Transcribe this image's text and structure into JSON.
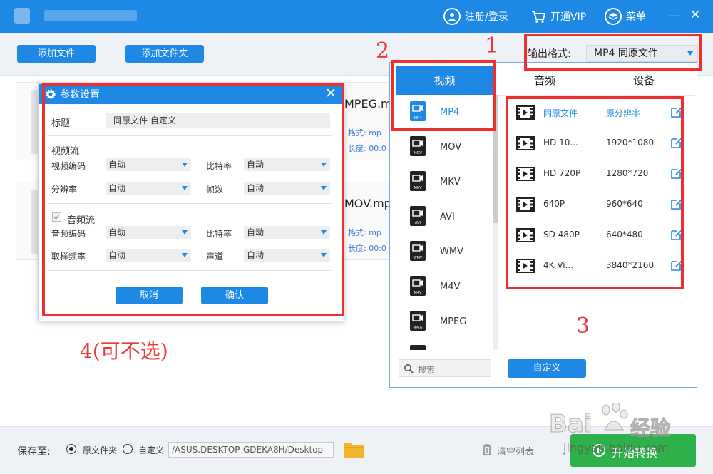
{
  "titlebar": {
    "login_label": "注册/登录",
    "vip_label": "开通VIP",
    "menu_label": "菜单",
    "minimize": "—",
    "close": "✕"
  },
  "toolbar": {
    "add_file": "添加文件",
    "add_folder": "添加文件夹"
  },
  "files": [
    {
      "name": "MPEG.m",
      "format_label": "格式: mp",
      "length_label": "长度: 00:0"
    },
    {
      "name": "MOV.mp",
      "format_label": "格式: mp",
      "length_label": "长度: 00:0"
    }
  ],
  "params_dialog": {
    "title": "参数设置",
    "title_label": "标题",
    "title_value": "同原文件 自定义",
    "video_section": "视频流",
    "video_codec_label": "视频编码",
    "video_codec_value": "自动",
    "video_bitrate_label": "比特率",
    "video_bitrate_value": "自动",
    "resolution_label": "分辨率",
    "resolution_value": "自动",
    "fps_label": "帧数",
    "fps_value": "自动",
    "audio_section": "音频流",
    "audio_codec_label": "音频编码",
    "audio_codec_value": "自动",
    "audio_bitrate_label": "比特率",
    "audio_bitrate_value": "自动",
    "sample_rate_label": "取样频率",
    "sample_rate_value": "自动",
    "channels_label": "声道",
    "channels_value": "自动",
    "cancel": "取消",
    "confirm": "确认"
  },
  "output": {
    "label": "输出格式:",
    "value": "MP4  同原文件"
  },
  "format_panel": {
    "tabs": [
      "视频",
      "音频",
      "设备"
    ],
    "active_tab": "视频",
    "formats": [
      {
        "label": "MP4",
        "tag": "MP4",
        "selected": true
      },
      {
        "label": "MOV",
        "tag": "MOV",
        "selected": false
      },
      {
        "label": "MKV",
        "tag": "MKV",
        "selected": false
      },
      {
        "label": "AVI",
        "tag": "AVI",
        "selected": false
      },
      {
        "label": "WMV",
        "tag": "WMV",
        "selected": false
      },
      {
        "label": "M4V",
        "tag": "M4V",
        "selected": false
      },
      {
        "label": "MPEG",
        "tag": "MPEG",
        "selected": false
      }
    ],
    "presets": [
      {
        "name": "同原文件",
        "resolution": "原分辨率",
        "highlight": true
      },
      {
        "name": "HD 10...",
        "resolution": "1920*1080",
        "highlight": false
      },
      {
        "name": "HD 720P",
        "resolution": "1280*720",
        "highlight": false
      },
      {
        "name": "640P",
        "resolution": "960*640",
        "highlight": false
      },
      {
        "name": "SD 480P",
        "resolution": "640*480",
        "highlight": false
      },
      {
        "name": "4K Vi...",
        "resolution": "3840*2160",
        "highlight": false
      }
    ],
    "search_placeholder": "搜索",
    "custom_button": "自定义"
  },
  "annotations": [
    "1",
    "2",
    "3",
    "4(可不选)"
  ],
  "bottom": {
    "save_to_label": "保存至:",
    "radio_source": "原文件夹",
    "radio_custom": "自定义",
    "path": "/ASUS.DESKTOP-GDEKA8H/Desktop",
    "clear_list": "清空列表",
    "start_convert": "开始转换"
  },
  "watermark": {
    "brand": "Bai",
    "brand_cn": "经验",
    "url": "jingyan.baidu.com"
  },
  "colors": {
    "primary": "#1e88e5",
    "annotation_red": "#ee2f2f",
    "start_green": "#2eb14a"
  }
}
